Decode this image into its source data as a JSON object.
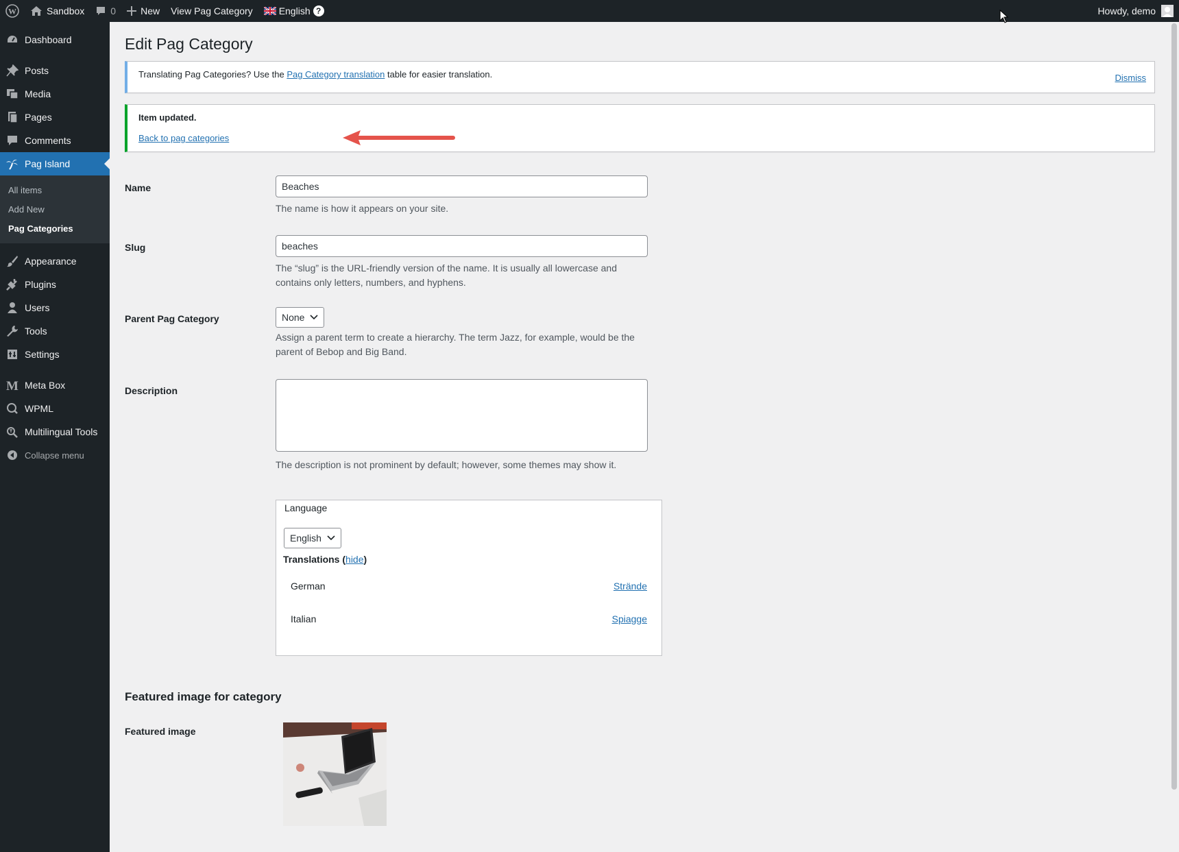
{
  "adminbar": {
    "site_name": "Sandbox",
    "comments_count": "0",
    "new_label": "New",
    "view_label": "View Pag Category",
    "language_label": "English",
    "help_glyph": "?",
    "howdy": "Howdy, demo"
  },
  "sidebar": {
    "items": [
      {
        "label": "Dashboard",
        "icon": "dashboard-icon"
      },
      {
        "label": "Posts",
        "icon": "pin-icon"
      },
      {
        "label": "Media",
        "icon": "media-icon"
      },
      {
        "label": "Pages",
        "icon": "pages-icon"
      },
      {
        "label": "Comments",
        "icon": "comment-icon"
      },
      {
        "label": "Pag Island",
        "icon": "palm-tree-icon"
      }
    ],
    "submenu": [
      "All items",
      "Add New",
      "Pag Categories"
    ],
    "items2": [
      {
        "label": "Appearance",
        "icon": "brush-icon"
      },
      {
        "label": "Plugins",
        "icon": "plug-icon"
      },
      {
        "label": "Users",
        "icon": "user-icon"
      },
      {
        "label": "Tools",
        "icon": "wrench-icon"
      },
      {
        "label": "Settings",
        "icon": "settings-icon"
      }
    ],
    "items3": [
      {
        "label": "Meta Box",
        "icon": "metabox-icon"
      },
      {
        "label": "WPML",
        "icon": "wpml-icon"
      },
      {
        "label": "Multilingual Tools",
        "icon": "multilingual-icon"
      }
    ],
    "collapse": "Collapse menu"
  },
  "page": {
    "title": "Edit Pag Category",
    "notice_info": {
      "prefix": "Translating Pag Categories? Use the ",
      "link": "Pag Category translation",
      "suffix": " table for easier translation.",
      "dismiss": "Dismiss"
    },
    "notice_success": {
      "message": "Item updated.",
      "back_link": "Back to pag categories"
    },
    "name": {
      "label": "Name",
      "value": "Beaches",
      "desc": "The name is how it appears on your site."
    },
    "slug": {
      "label": "Slug",
      "value": "beaches",
      "desc": "The “slug” is the URL-friendly version of the name. It is usually all lowercase and contains only letters, numbers, and hyphens."
    },
    "parent": {
      "label": "Parent Pag Category",
      "value": "None",
      "desc": "Assign a parent term to create a hierarchy. The term Jazz, for example, would be the parent of Bebop and Big Band."
    },
    "description": {
      "label": "Description",
      "desc": "The description is not prominent by default; however, some themes may show it."
    },
    "language_box": {
      "title": "Language",
      "selected": "English",
      "translations_label": "Translations",
      "hide_label": "hide",
      "translations": [
        {
          "language": "German",
          "term": "Strände"
        },
        {
          "language": "Italian",
          "term": "Spiagge"
        }
      ]
    },
    "featured": {
      "section_title": "Featured image for category",
      "label": "Featured image"
    }
  },
  "colors": {
    "admin_bg": "#1d2327",
    "accent": "#2271b1",
    "success": "#00a32a",
    "info": "#72aee6",
    "annotation_arrow": "#e5534b"
  }
}
